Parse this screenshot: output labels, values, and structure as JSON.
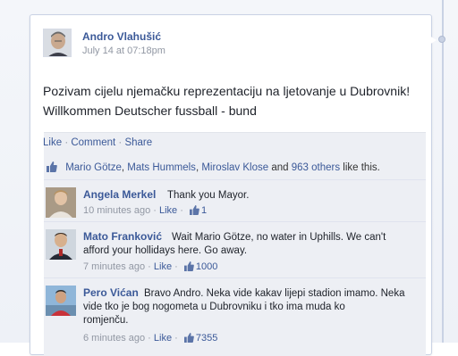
{
  "post": {
    "author": "Andro Vlahušić",
    "timestamp": "July 14 at 07:18pm",
    "text_line1": "Pozivam cijelu njemačku reprezentaciju na ljetovanje u Dubrovnik!",
    "text_line2": "Willkommen Deutscher fussball - bund"
  },
  "actions": {
    "like": "Like",
    "dot": "·",
    "comment": "Comment",
    "share": "Share"
  },
  "likes": {
    "name1": "Mario Götze",
    "comma": ",",
    "name2": "Mats Hummels",
    "name3": "Miroslav Klose",
    "and": "and",
    "others": "963 others",
    "suffix": "like this."
  },
  "comments": [
    {
      "name": "Angela Merkel",
      "text": "Thank you Mayor.",
      "time": "10 minutes ago",
      "like": "Like",
      "count": "1"
    },
    {
      "name": "Mato Franković",
      "text_line1": "Wait Mario Götze, no water in Uphills. We can't",
      "text_line2": "afford your hollidays here. Go away.",
      "time": "7 minutes ago",
      "like": "Like",
      "count": "1000"
    },
    {
      "name": "Pero Vićan",
      "text_line1": "Bravo Andro. Neka vide kakav lijepi stadion imamo. Neka",
      "text_line2": "vide tko je bog nogometa u Dubrovniku i tko ima muda ko",
      "text_line3": "romjenču.",
      "time": "6 minutes ago",
      "like": "Like",
      "count": "7355"
    }
  ],
  "colors": {
    "link": "#3b5998",
    "muted": "#9197a3",
    "social_bg": "#edeff4"
  }
}
